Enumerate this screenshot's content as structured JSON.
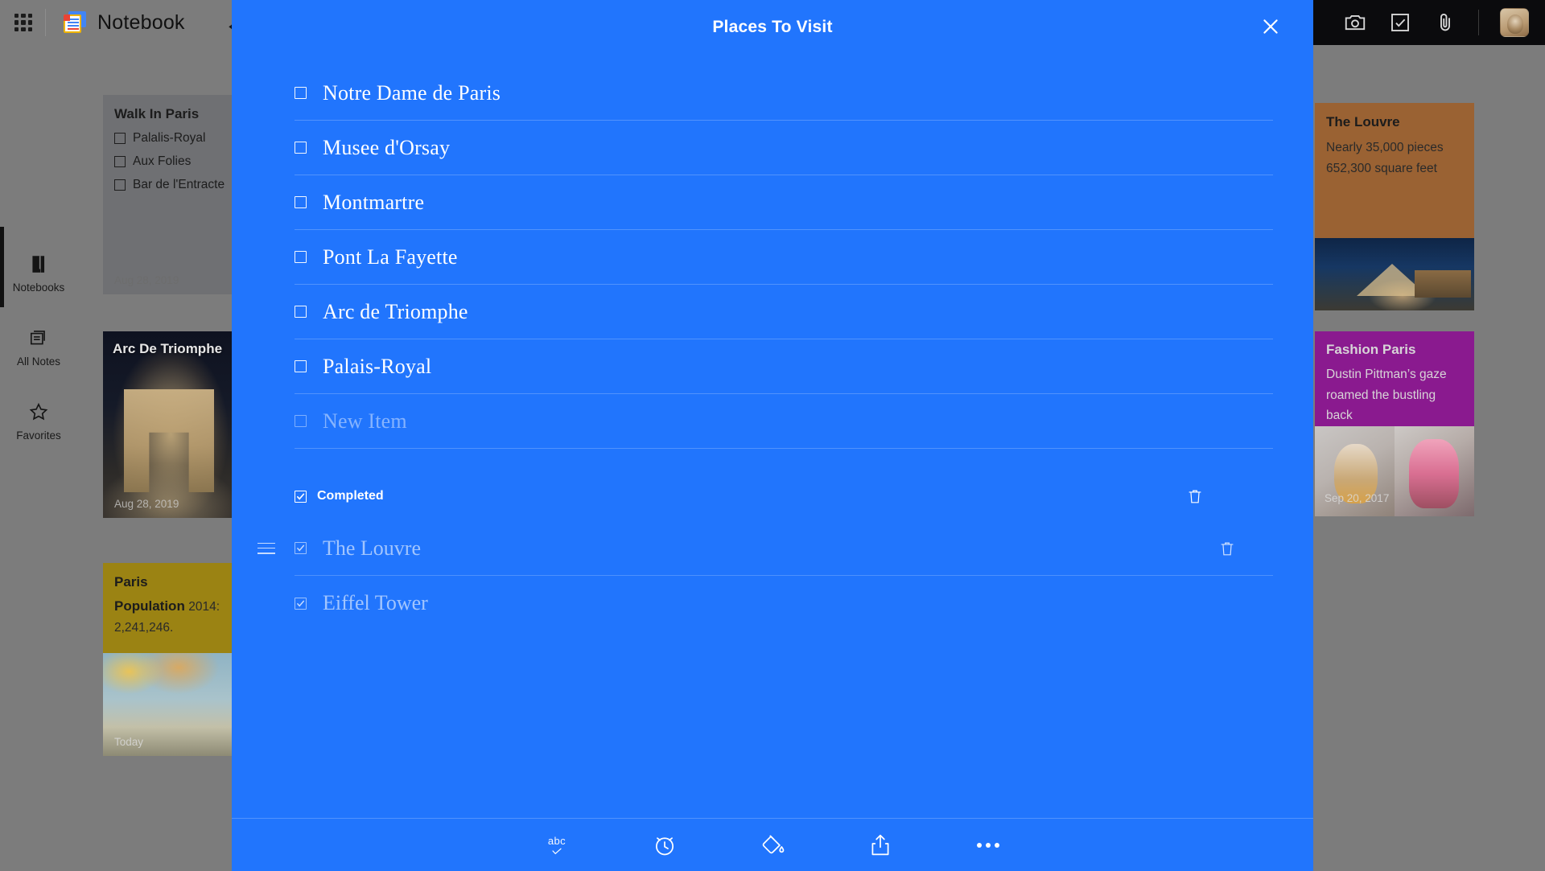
{
  "topbar": {
    "grid_icon": "apps-grid-icon",
    "logo_icon": "notebook-logo-icon",
    "app_title": "Notebook",
    "back_icon": "back-arrow-icon",
    "actions": [
      {
        "icon": "camera-icon"
      },
      {
        "icon": "checklist-icon"
      },
      {
        "icon": "paperclip-icon"
      }
    ],
    "avatar": "user-avatar"
  },
  "sidebar": {
    "items": [
      {
        "label": "Notebooks",
        "icon": "notebook-icon",
        "active": true
      },
      {
        "label": "All Notes",
        "icon": "notes-stack-icon",
        "active": false
      },
      {
        "label": "Favorites",
        "icon": "star-icon",
        "active": false
      }
    ]
  },
  "cards": {
    "walk_in_paris": {
      "title": "Walk In Paris",
      "items": [
        "Palalis-Royal",
        "Aux Folies",
        "Bar de l'Entracte"
      ],
      "date": "Aug 28, 2019",
      "color": "#6f7073"
    },
    "arc_de_triomphe": {
      "title": "Arc De Triomphe",
      "date": "Aug 28, 2019"
    },
    "paris": {
      "title": "Paris",
      "subtitle": "Population",
      "text": "2014: 2,241,246.",
      "date": "Today",
      "color": "#9b8313"
    },
    "the_louvre": {
      "title": "The Louvre",
      "text": "Nearly 35,000 pieces 652,300 square feet",
      "color": "#9a6233"
    },
    "fashion_paris": {
      "title": "Fashion Paris",
      "text": "Dustin Pittman’s gaze roamed the bustling back",
      "date": "Sep 20, 2017",
      "color": "#8a1a8f"
    }
  },
  "modal": {
    "title": "Places To Visit",
    "close_icon": "close-icon",
    "accent_color": "#2175fd",
    "items": [
      {
        "label": "Notre Dame de Paris",
        "checked": false
      },
      {
        "label": "Musee d'Orsay",
        "checked": false
      },
      {
        "label": "Montmartre",
        "checked": false
      },
      {
        "label": "Pont La Fayette",
        "checked": false
      },
      {
        "label": "Arc de Triomphe",
        "checked": false
      },
      {
        "label": "Palais-Royal",
        "checked": false
      }
    ],
    "new_item_placeholder": "New Item",
    "completed": {
      "label": "Completed",
      "delete_icon": "trash-icon",
      "items": [
        {
          "label": "The Louvre",
          "checked": true,
          "has_drag_handle": true,
          "delete_icon": "trash-icon"
        },
        {
          "label": "Eiffel Tower",
          "checked": true,
          "has_drag_handle": false
        }
      ]
    },
    "footer": [
      {
        "icon": "spellcheck-icon",
        "label": "abc"
      },
      {
        "icon": "alarm-clock-icon"
      },
      {
        "icon": "paint-bucket-icon"
      },
      {
        "icon": "share-icon"
      },
      {
        "icon": "more-icon"
      }
    ]
  }
}
